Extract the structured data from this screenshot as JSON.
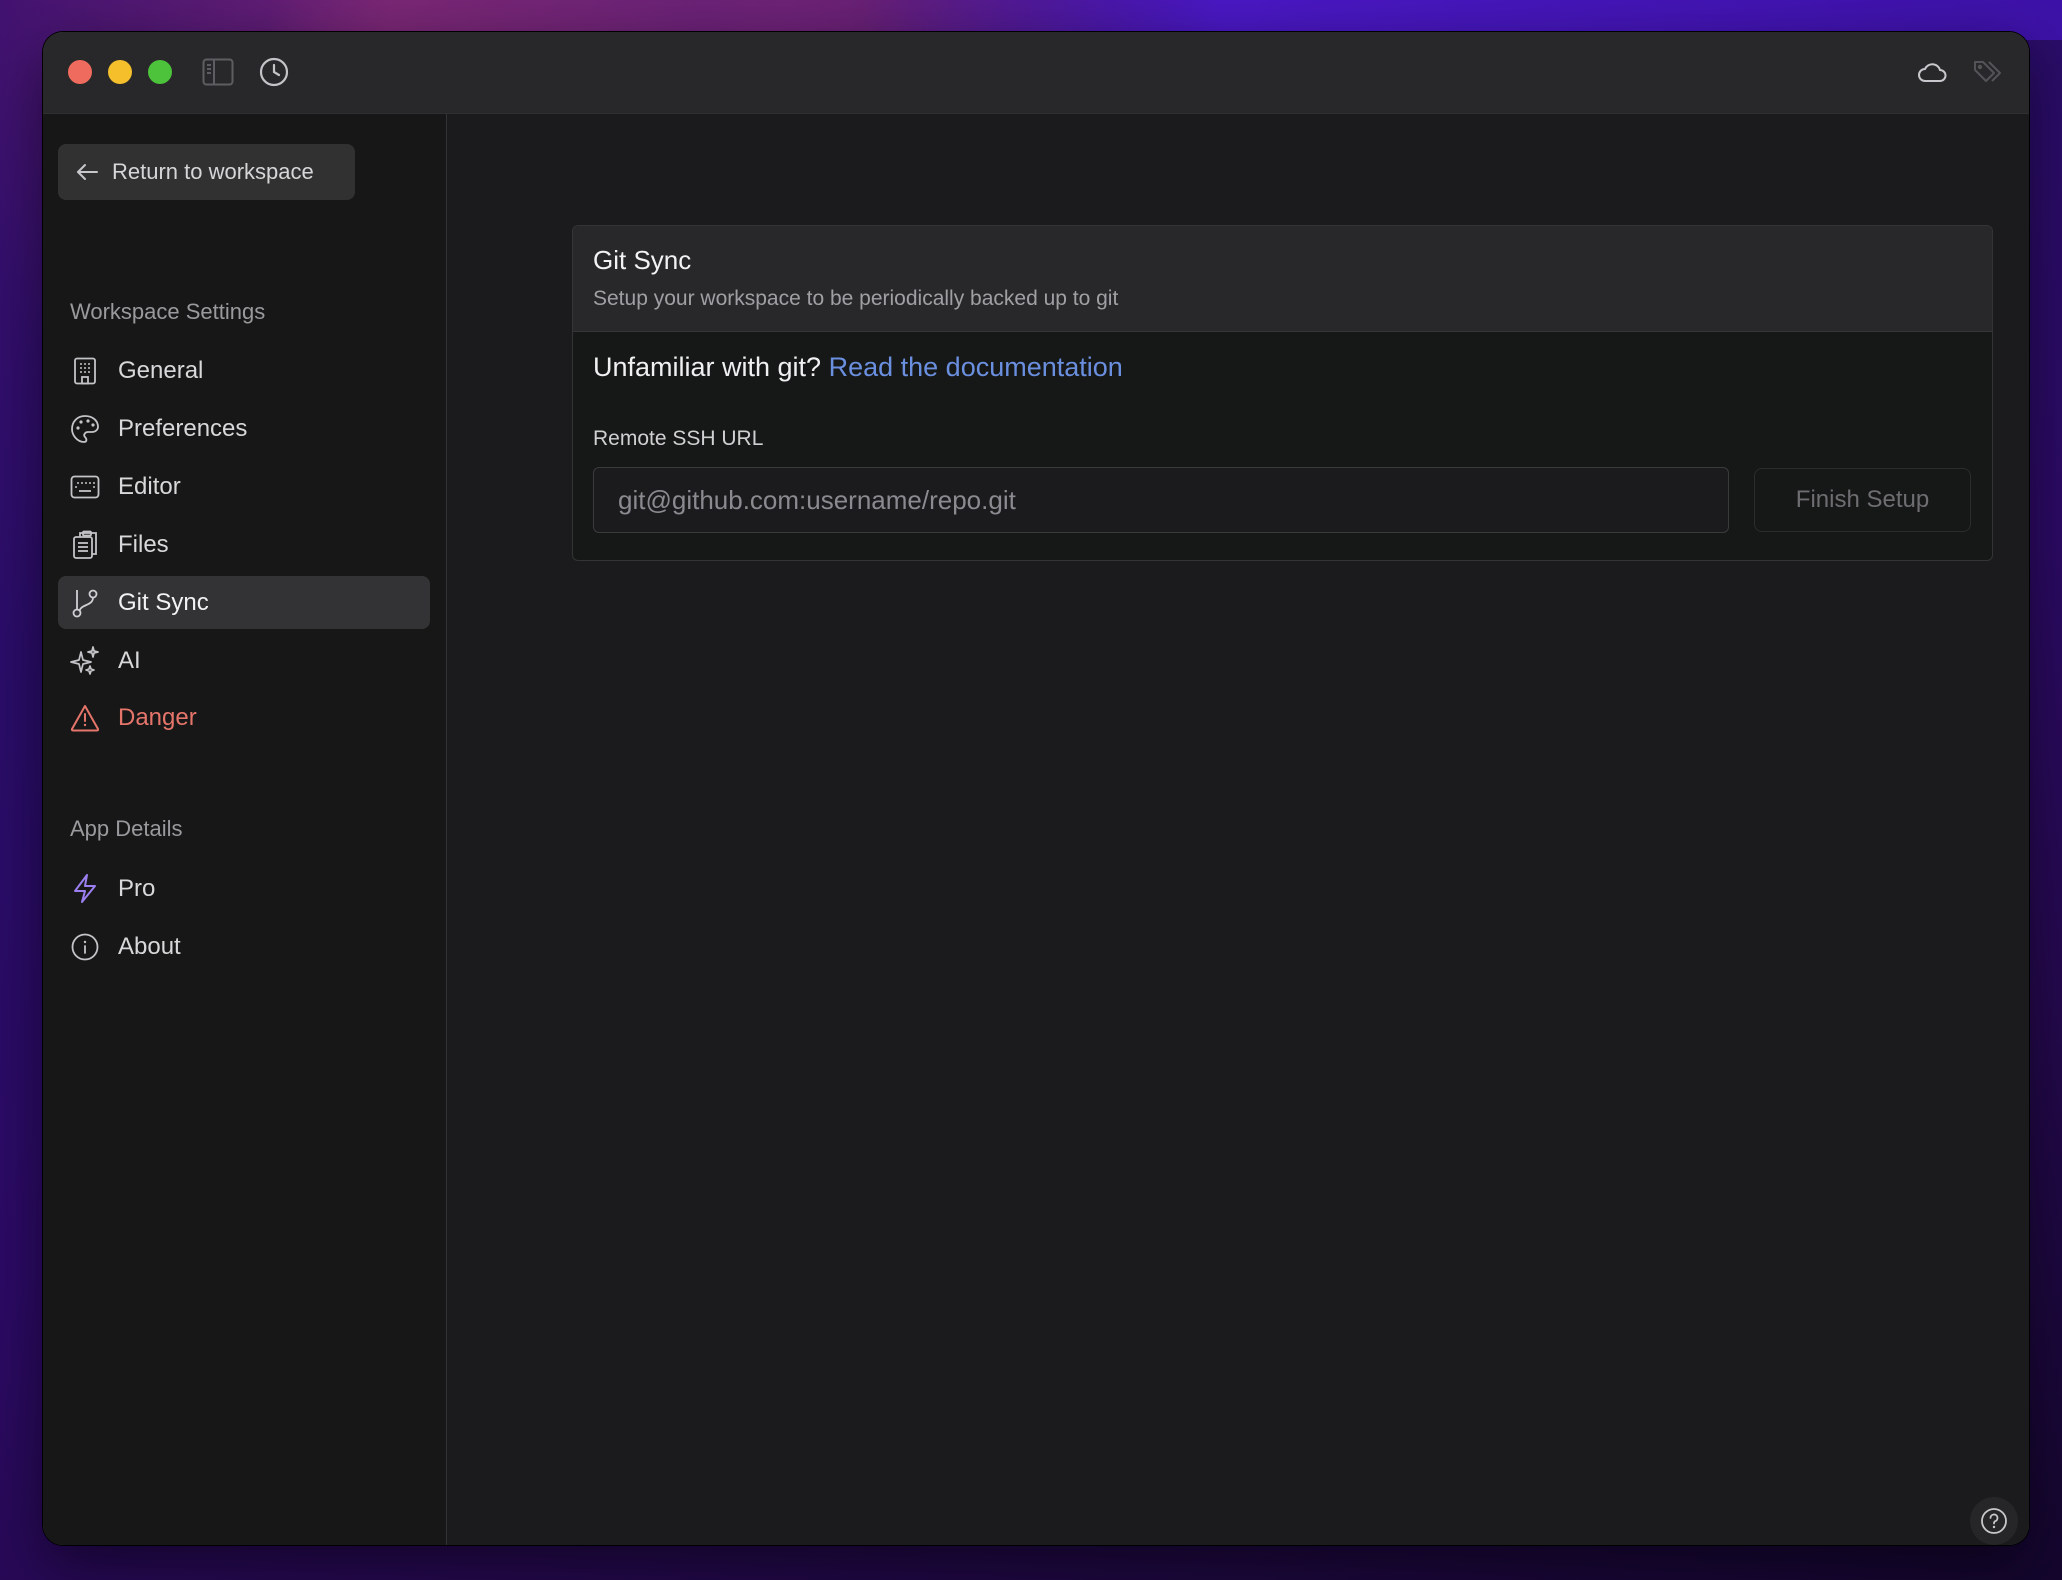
{
  "titlebar": {
    "window_controls": [
      "close",
      "minimize",
      "maximize"
    ],
    "left_icons": [
      "sidebar-toggle-icon",
      "history-icon"
    ],
    "right_icons": [
      "cloud-icon",
      "tags-icon"
    ]
  },
  "sidebar": {
    "return_label": "Return to workspace",
    "sections": [
      {
        "label": "Workspace Settings",
        "items": [
          {
            "label": "General",
            "icon": "building-icon",
            "active": false
          },
          {
            "label": "Preferences",
            "icon": "palette-icon",
            "active": false
          },
          {
            "label": "Editor",
            "icon": "keyboard-icon",
            "active": false
          },
          {
            "label": "Files",
            "icon": "clipboard-icon",
            "active": false
          },
          {
            "label": "Git Sync",
            "icon": "git-branch-icon",
            "active": true
          },
          {
            "label": "AI",
            "icon": "sparkles-icon",
            "active": false
          },
          {
            "label": "Danger",
            "icon": "warning-icon",
            "active": false,
            "color": "#e5756b"
          }
        ]
      },
      {
        "label": "App Details",
        "items": [
          {
            "label": "Pro",
            "icon": "bolt-icon",
            "active": false,
            "icon_color": "#9b7ff0"
          },
          {
            "label": "About",
            "icon": "info-icon",
            "active": false
          }
        ]
      }
    ]
  },
  "main": {
    "card": {
      "title": "Git Sync",
      "subtitle": "Setup your workspace to be periodically backed up to git",
      "intro_text": "Unfamiliar with git?",
      "doc_link": "Read the documentation",
      "field_label": "Remote SSH URL",
      "url_value": "",
      "url_placeholder": "git@github.com:username/repo.git",
      "submit_label": "Finish Setup"
    },
    "help_icon": "help-icon"
  },
  "colors": {
    "accent_link": "#6a8fdf",
    "danger": "#e5756b",
    "pro": "#9b7ff0"
  }
}
